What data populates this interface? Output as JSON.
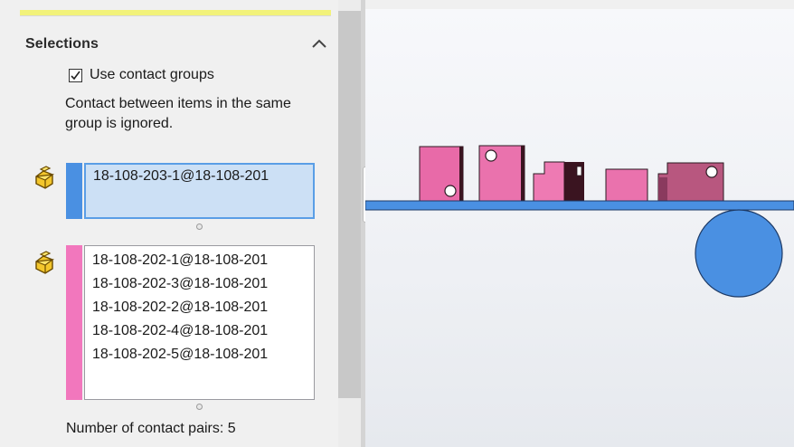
{
  "panel": {
    "section_title": "Selections",
    "use_contact_groups": {
      "label": "Use contact groups",
      "checked": true
    },
    "description": "Contact between items in the same group is ignored.",
    "group1": {
      "color": "#4a90e2",
      "items": [
        "18-108-203-1@18-108-201"
      ]
    },
    "group2": {
      "color": "#f277bd",
      "items": [
        "18-108-202-1@18-108-201",
        "18-108-202-3@18-108-201",
        "18-108-202-2@18-108-201",
        "18-108-202-4@18-108-201",
        "18-108-202-5@18-108-201"
      ]
    },
    "contact_pairs_text": "Number of contact pairs: 5"
  },
  "icons": {
    "collapse": "chevron-up-icon",
    "component": "part-component-icon",
    "checkbox": "checkmark-icon"
  },
  "colors": {
    "accent_yellow": "#f2f27a",
    "selection_blue": "#cce0f5",
    "selection_border": "#5a9ee6",
    "part_pink": "#e86aa8",
    "part_dark": "#3a1420",
    "conveyor_blue": "#4a90e2"
  }
}
